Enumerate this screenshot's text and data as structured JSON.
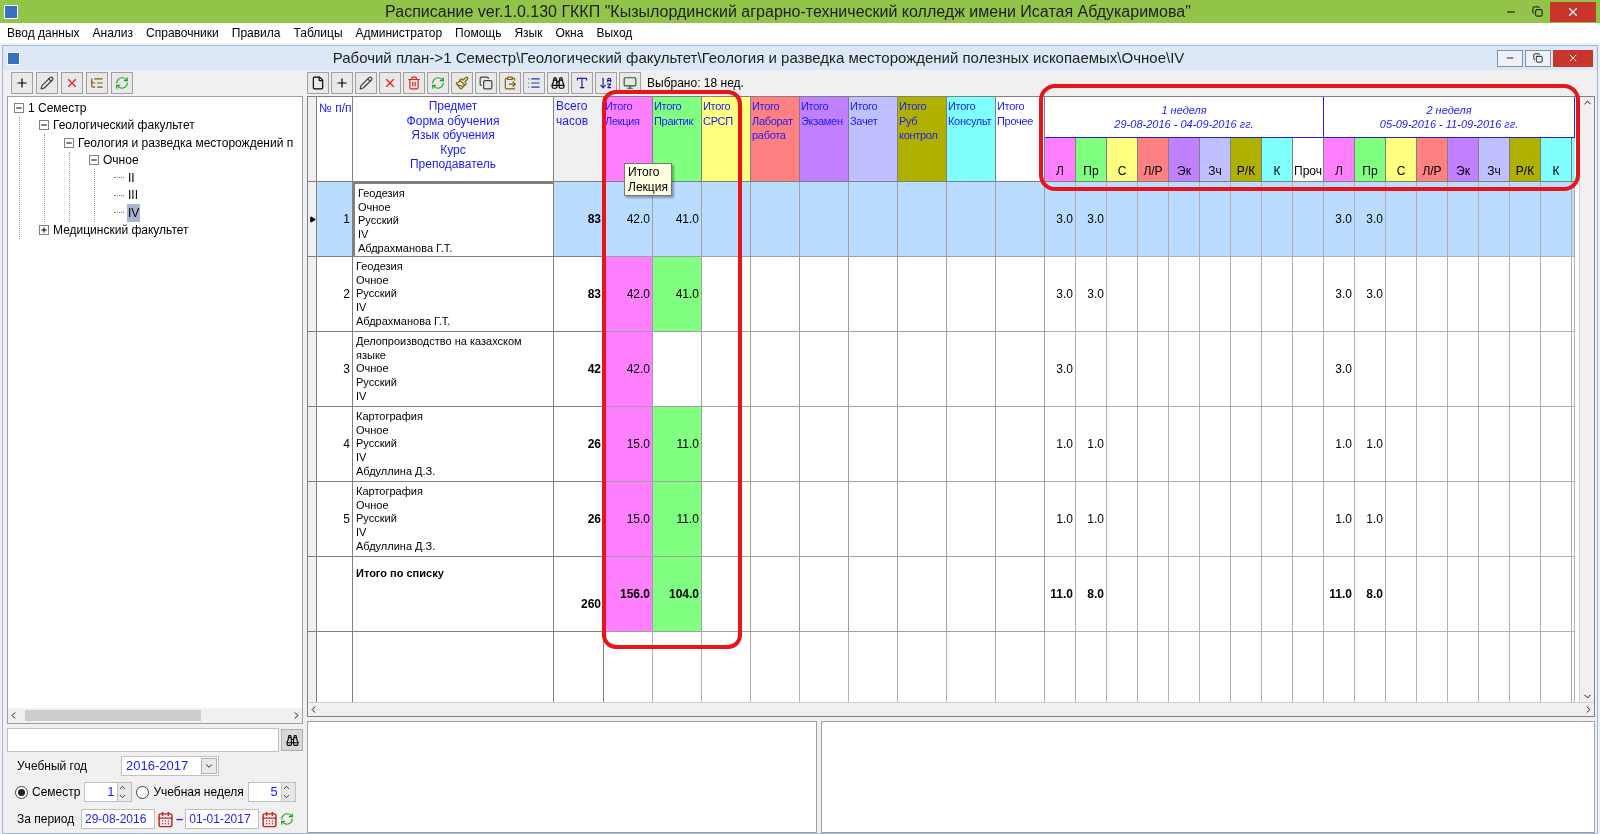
{
  "app": {
    "title": "Расписание ver.1.0.130 ГККП \"Кызылординский аграрно-технический колледж имени Исатая Абдукаримова\""
  },
  "menu": [
    "Ввод данных",
    "Анализ",
    "Справочники",
    "Правила",
    "Таблицы",
    "Администратор",
    "Помощь",
    "Язык",
    "Окна",
    "Выход"
  ],
  "window": {
    "title": "Рабочий план->1 Семестр\\Геологический факультет\\Геология и разведка месторождений полезных ископаемых\\Очное\\IV"
  },
  "tree": [
    {
      "label": "1 Семестр",
      "expanded": true,
      "selected": false,
      "children": [
        {
          "label": "Геологический факультет",
          "expanded": true,
          "selected": false,
          "children": [
            {
              "label": "Геология и разведка месторождений п",
              "expanded": true,
              "selected": false,
              "children": [
                {
                  "label": "Очное",
                  "expanded": true,
                  "selected": false,
                  "children": [
                    {
                      "label": "II",
                      "selected": false
                    },
                    {
                      "label": "III",
                      "selected": false
                    },
                    {
                      "label": "IV",
                      "selected": true
                    }
                  ]
                }
              ]
            }
          ]
        },
        {
          "label": "Медицинский факультет",
          "expanded": false,
          "selected": false
        }
      ]
    }
  ],
  "filters": {
    "year_label": "Учебный год",
    "year": "2016-2017",
    "modes": [
      {
        "label": "Семестр",
        "value": "1",
        "selected": true
      },
      {
        "label": "Учебная неделя",
        "value": "5",
        "selected": false
      }
    ],
    "period_label": "За период",
    "from": "29-08-2016",
    "separator": "–",
    "to": "01-01-2017"
  },
  "toolbar": {
    "status": "Выбрано: 18 нед."
  },
  "table": {
    "headers": {
      "number": "№ п/п",
      "subject": [
        "Предмет",
        "Форма обучения",
        "Язык обучения",
        "Курс",
        "Преподаватель"
      ],
      "total": [
        "Всего",
        "часов"
      ]
    },
    "summary_columns": [
      {
        "lines": [
          "Итого",
          "Лекция"
        ],
        "color": "#ff80ff"
      },
      {
        "lines": [
          "Итого",
          "Практик"
        ],
        "color": "#80ff80"
      },
      {
        "lines": [
          "Итого",
          "СРСП"
        ],
        "color": "#ffff80"
      },
      {
        "lines": [
          "Итого",
          "Лаборат",
          "работа"
        ],
        "color": "#ff8080"
      },
      {
        "lines": [
          "Итого",
          "Экзамен"
        ],
        "color": "#c080ff"
      },
      {
        "lines": [
          "Итого",
          "Зачет"
        ],
        "color": "#c0c0ff"
      },
      {
        "lines": [
          "Итого",
          "Руб",
          "контрол"
        ],
        "color": "#b0b000"
      },
      {
        "lines": [
          "Итого",
          "Консульт"
        ],
        "color": "#80ffff"
      },
      {
        "lines": [
          "Итого",
          "Прочее"
        ],
        "color": "#ffffff"
      }
    ],
    "weeks": [
      {
        "title": "1 неделя",
        "dates": "29-08-2016 - 04-09-2016 гг.",
        "subcolumns": [
          {
            "label": "Л",
            "color": "#ff80ff"
          },
          {
            "label": "Пр",
            "color": "#80ff80"
          },
          {
            "label": "С",
            "color": "#ffff80"
          },
          {
            "label": "Л/Р",
            "color": "#ff8080"
          },
          {
            "label": "Эк",
            "color": "#c080ff"
          },
          {
            "label": "Зч",
            "color": "#c0c0ff"
          },
          {
            "label": "Р/К",
            "color": "#b0b000"
          },
          {
            "label": "К",
            "color": "#80ffff"
          },
          {
            "label": "Проч",
            "color": "#ffffff"
          }
        ]
      },
      {
        "title": "2 неделя",
        "dates": "05-09-2016 - 11-09-2016 гг.",
        "subcolumns": [
          {
            "label": "Л",
            "color": "#ff80ff"
          },
          {
            "label": "Пр",
            "color": "#80ff80"
          },
          {
            "label": "С",
            "color": "#ffff80"
          },
          {
            "label": "Л/Р",
            "color": "#ff8080"
          },
          {
            "label": "Эк",
            "color": "#c080ff"
          },
          {
            "label": "Зч",
            "color": "#c0c0ff"
          },
          {
            "label": "Р/К",
            "color": "#b0b000"
          },
          {
            "label": "К",
            "color": "#80ffff"
          }
        ]
      }
    ],
    "rows": [
      {
        "number": "1",
        "selected": true,
        "subject": [
          "Геодезия",
          "Очное",
          "Русский",
          "IV",
          "Абдрахманова Г.Т."
        ],
        "total": "83",
        "summary": [
          "42.0",
          "41.0"
        ],
        "weeks": [
          [
            "3.0",
            "3.0"
          ],
          [
            "3.0",
            "3.0"
          ]
        ]
      },
      {
        "number": "2",
        "selected": false,
        "subject": [
          "Геодезия",
          "Очное",
          "Русский",
          "IV",
          "Абдрахманова Г.Т."
        ],
        "total": "83",
        "summary": [
          "42.0",
          "41.0"
        ],
        "weeks": [
          [
            "3.0",
            "3.0"
          ],
          [
            "3.0",
            "3.0"
          ]
        ]
      },
      {
        "number": "3",
        "selected": false,
        "subject": [
          "Делопроизводство на казахском языке",
          "Очное",
          "Русский",
          "IV"
        ],
        "total": "42",
        "summary": [
          "42.0"
        ],
        "weeks": [
          [
            "3.0"
          ],
          [
            "3.0"
          ]
        ]
      },
      {
        "number": "4",
        "selected": false,
        "subject": [
          "Картография",
          "Очное",
          "Русский",
          "IV",
          "Абдуллина Д.З."
        ],
        "total": "26",
        "summary": [
          "15.0",
          "11.0"
        ],
        "weeks": [
          [
            "1.0",
            "1.0"
          ],
          [
            "1.0",
            "1.0"
          ]
        ]
      },
      {
        "number": "5",
        "selected": false,
        "subject": [
          "Картография",
          "Очное",
          "Русский",
          "IV",
          "Абдуллина Д.З."
        ],
        "total": "26",
        "summary": [
          "15.0",
          "11.0"
        ],
        "weeks": [
          [
            "1.0",
            "1.0"
          ],
          [
            "1.0",
            "1.0"
          ]
        ]
      }
    ],
    "totals": {
      "label": "Итого по списку",
      "total": "260",
      "summary": [
        "156.0",
        "104.0"
      ],
      "weeks": [
        [
          "11.0",
          "8.0"
        ],
        [
          "11.0",
          "8.0"
        ]
      ]
    },
    "tooltip": [
      "Итого",
      "Лекция"
    ]
  }
}
